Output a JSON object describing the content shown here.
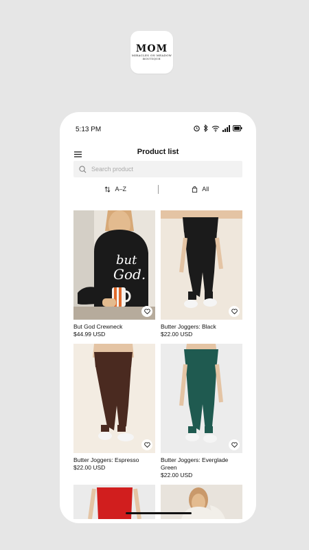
{
  "brand": {
    "logo_main": "MOM",
    "logo_sub": "MIRACLES ON MEADOW",
    "logo_sub2": "BOUTIQUE"
  },
  "status_bar": {
    "time": "5:13 PM"
  },
  "header": {
    "title": "Product list"
  },
  "search": {
    "placeholder": "Search product"
  },
  "filters": {
    "sort_label": "A–Z",
    "category_label": "All"
  },
  "products": [
    {
      "name": "But God Crewneck",
      "price": "$44.99 USD"
    },
    {
      "name": "Butter Joggers: Black",
      "price": "$22.00 USD"
    },
    {
      "name": "Butter Joggers: Espresso",
      "price": "$22.00 USD"
    },
    {
      "name": "Butter Joggers: Everglade Green",
      "price": "$22.00 USD"
    }
  ],
  "colors": {
    "black_jogger": "#1b1b1b",
    "espresso_jogger": "#4a2a20",
    "green_jogger": "#1f5a50",
    "red": "#d11e1e"
  },
  "icons": [
    "menu-icon",
    "search-icon",
    "sort-icon",
    "bag-icon",
    "heart-icon",
    "alarm-icon",
    "bluetooth-icon",
    "wifi-icon",
    "signal-icon",
    "battery-icon"
  ]
}
